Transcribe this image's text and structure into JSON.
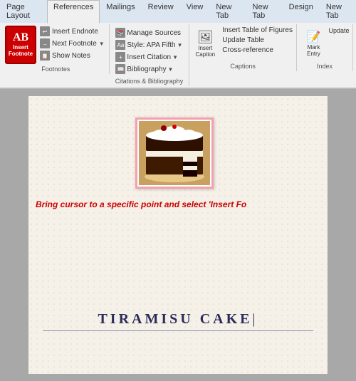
{
  "tabs": [
    {
      "label": "Page Layout",
      "active": false
    },
    {
      "label": "References",
      "active": true
    },
    {
      "label": "Mailings",
      "active": false
    },
    {
      "label": "Review",
      "active": false
    },
    {
      "label": "View",
      "active": false
    },
    {
      "label": "New Tab",
      "active": false
    },
    {
      "label": "New Tab",
      "active": false
    },
    {
      "label": "Design",
      "active": false
    },
    {
      "label": "New Tab",
      "active": false
    }
  ],
  "footnotes_group": {
    "label": "Footnotes",
    "insert_footnote": "Insert\nFootnote",
    "ab_text": "AB",
    "buttons": [
      "Insert Endnote",
      "Next Footnote",
      "Show Notes"
    ]
  },
  "citations_group": {
    "label": "Citations & Bibliography",
    "buttons": [
      "Manage Sources",
      "Style: APA Fifth",
      "Insert Citation",
      "Bibliography"
    ]
  },
  "captions_group": {
    "label": "Captions",
    "insert_caption": "Insert\nCaption",
    "buttons": [
      "Insert Table of Figures",
      "Update Table",
      "Cross-reference"
    ]
  },
  "index_group": {
    "label": "Index",
    "mark_entry": "Mark\nEntry",
    "update": "Update"
  },
  "document": {
    "instruction_text": "Bring cursor to a specific point and select 'Insert Fo",
    "title": "TIRAMISU CAKE"
  }
}
